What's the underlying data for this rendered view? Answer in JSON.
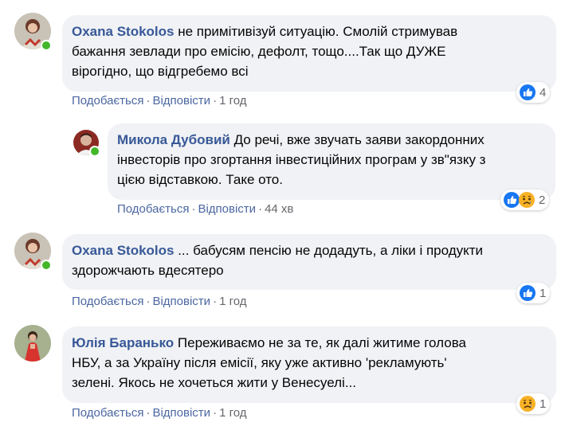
{
  "colors": {
    "bubble": "#f0f2f5",
    "author": "#385898",
    "action_link": "#4b67a1",
    "meta": "#65676b",
    "like_blue": "#1877f2",
    "sad_yellow": "#f7b125",
    "online": "#42b72a"
  },
  "comments": [
    {
      "author": "Oxana Stokolos",
      "text_lines": [
        " не примітивізуй ситуацію. Смолій стримував",
        "бажання зевлади про емісію, дефолт, тощо....Так що ДУЖЕ",
        "вірогідно, що відгребемо всі"
      ],
      "like_label": "Подобається",
      "reply_label": "Відповісти",
      "time": "1 год",
      "reactions": [
        "like-icon"
      ],
      "reaction_count": "4"
    },
    {
      "author": "Микола Дубовий",
      "text_lines": [
        " До речі, вже звучать заяви закордонних",
        "інвесторів про згортання інвестиційних програм у зв\"язку з",
        "цією відставкою. Таке ото."
      ],
      "like_label": "Подобається",
      "reply_label": "Відповісти",
      "time": "44 хв",
      "reactions": [
        "like-icon",
        "sad-icon"
      ],
      "reaction_count": "2"
    },
    {
      "author": "Oxana Stokolos",
      "text_lines": [
        " ... бабусям пенсію не додадуть, а ліки і продукти",
        "здорожчають вдесятеро"
      ],
      "like_label": "Подобається",
      "reply_label": "Відповісти",
      "time": "1 год",
      "reactions": [
        "like-icon"
      ],
      "reaction_count": "1"
    },
    {
      "author": "Юлія Баранько",
      "text_lines": [
        " Переживаємо не за те, як далі житиме голова",
        "НБУ, а за Україну після емісії, яку уже активно 'рекламують'",
        "зелені. Якось не хочеться жити у Венесуелі..."
      ],
      "like_label": "Подобається",
      "reply_label": "Відповісти",
      "time": "1 год",
      "reactions": [
        "sad-icon"
      ],
      "reaction_count": "1"
    }
  ]
}
